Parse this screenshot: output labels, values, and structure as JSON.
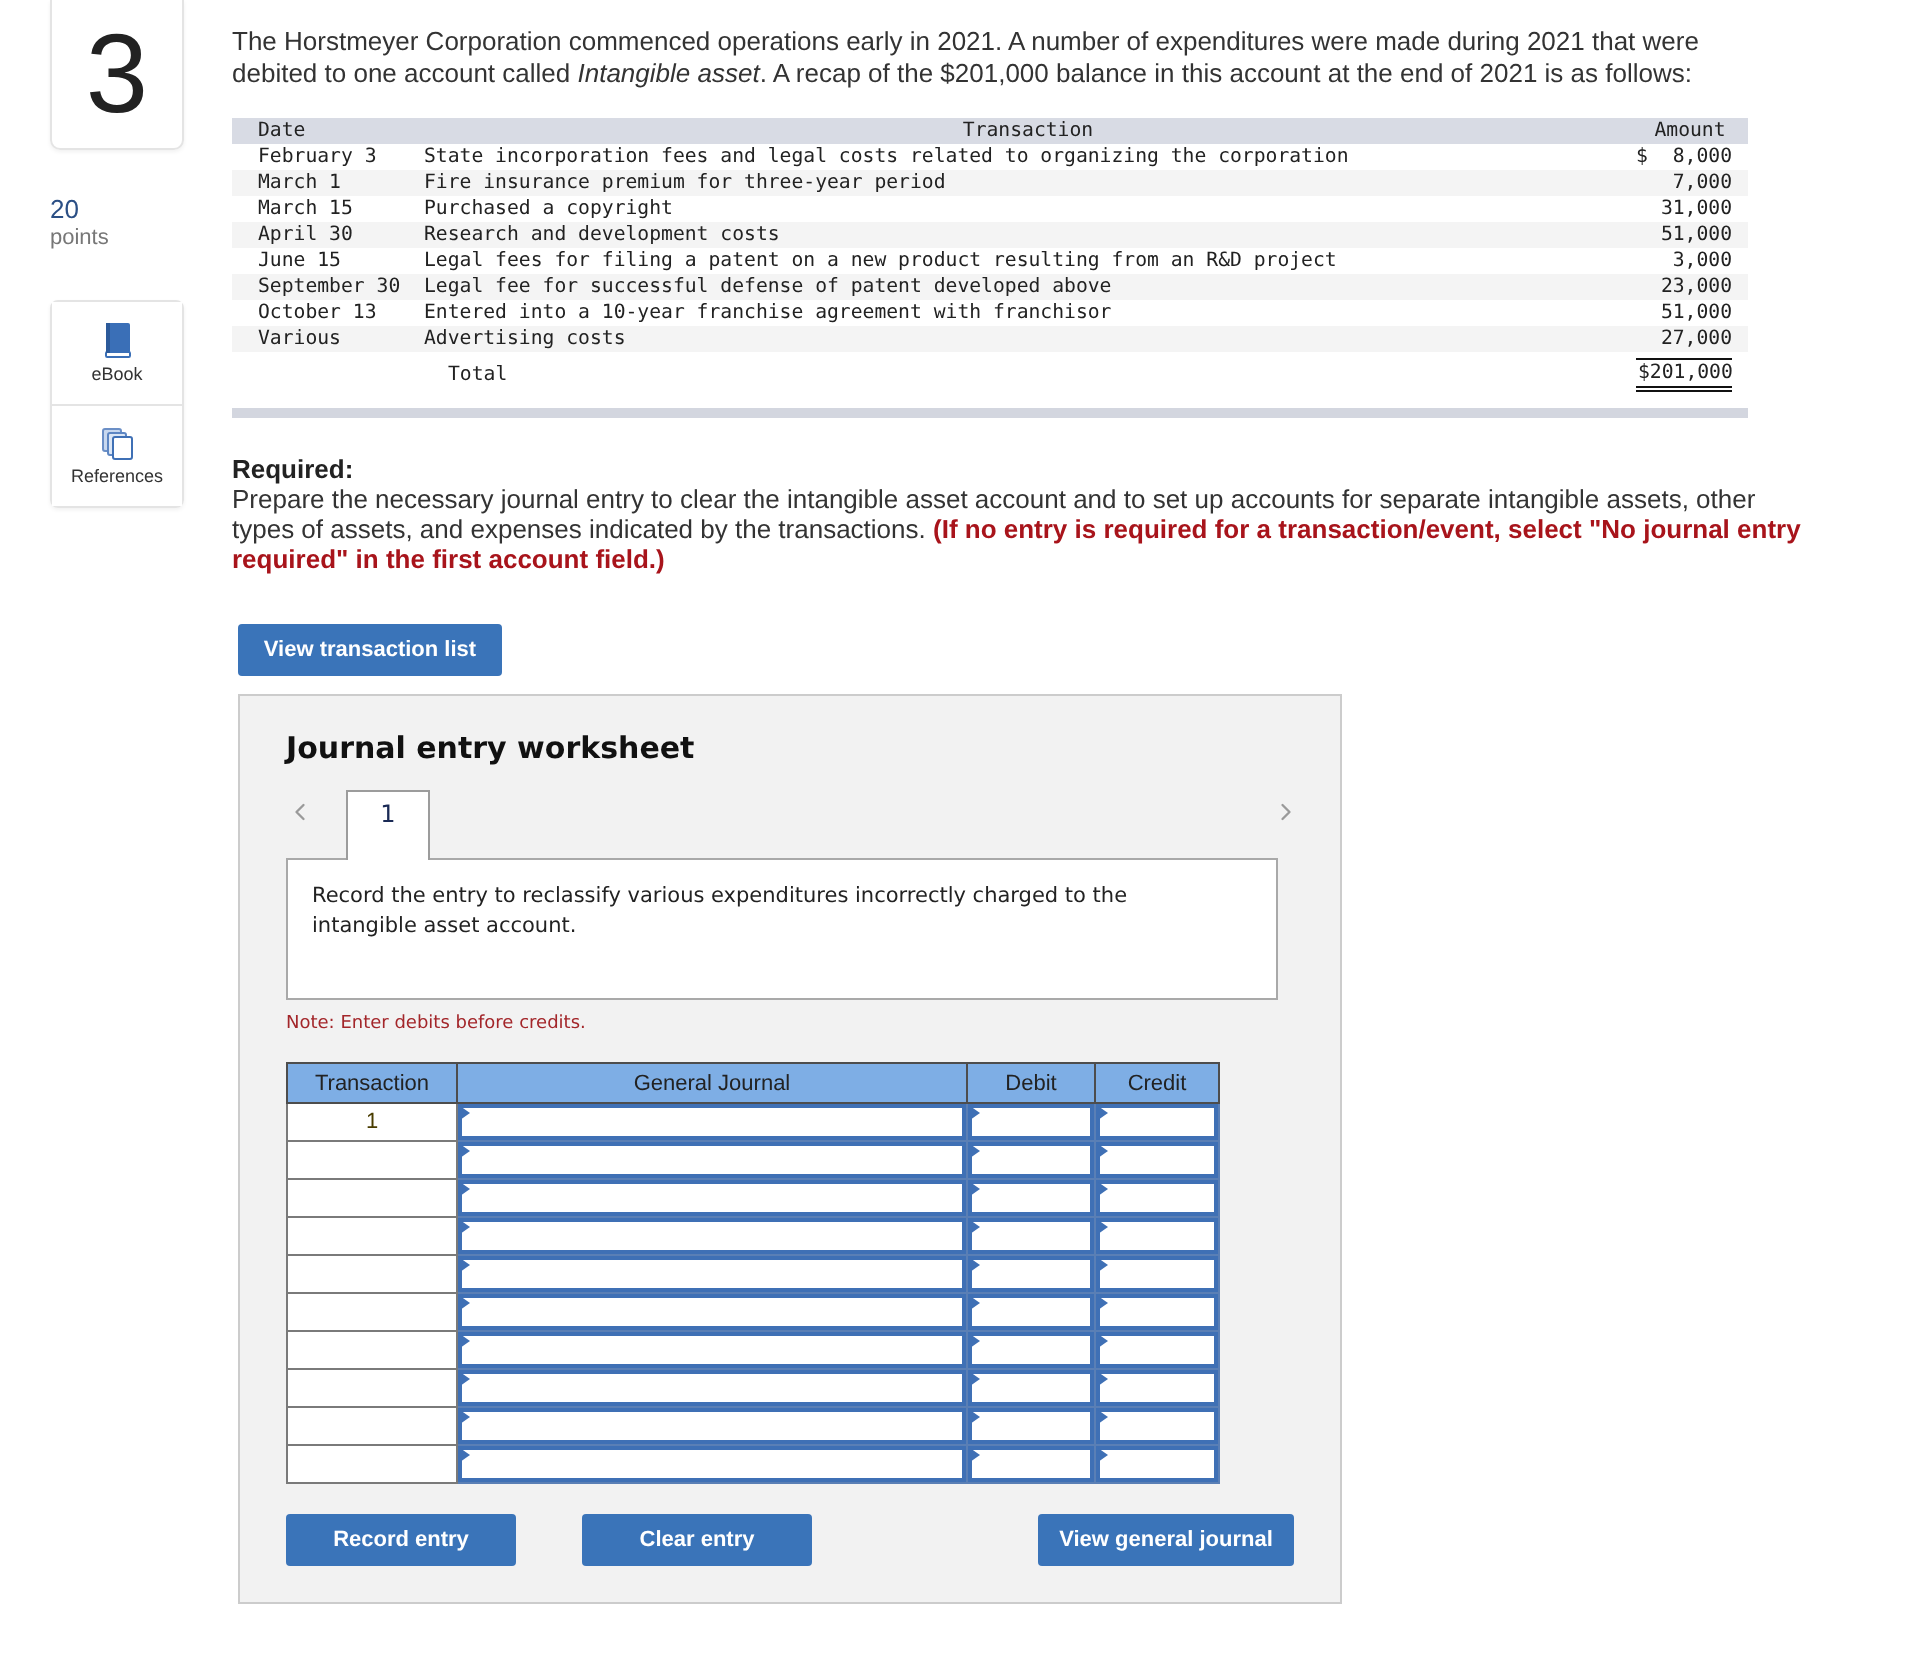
{
  "question": {
    "number": "3",
    "points": "20",
    "points_label": "points"
  },
  "resources": [
    {
      "kind": "ebook",
      "label": "eBook"
    },
    {
      "kind": "references",
      "label": "References"
    }
  ],
  "intro": "The Horstmeyer Corporation commenced operations early in 2021. A number of expenditures were made during 2021 that were debited to one account called *Intangible asset*. A recap of the $201,000 balance in this account at the end of 2021 is as follows:",
  "recap_table": {
    "columns": [
      "Date",
      "Transaction",
      "Amount"
    ],
    "rows": [
      {
        "date": "February 3",
        "description": "State incorporation fees and legal costs related to organizing the corporation",
        "currency": "$",
        "amount": "8,000"
      },
      {
        "date": "March 1",
        "description": "Fire insurance premium for three-year period",
        "amount": "7,000"
      },
      {
        "date": "March 15",
        "description": "Purchased a copyright",
        "amount": "31,000"
      },
      {
        "date": "April 30",
        "description": "Research and development costs",
        "amount": "51,000"
      },
      {
        "date": "June 15",
        "description": "Legal fees for filing a patent on a new product resulting from an R&D project",
        "amount": "3,000"
      },
      {
        "date": "September 30",
        "description": "Legal fee for successful defense of patent developed above",
        "amount": "23,000"
      },
      {
        "date": "October 13",
        "description": "Entered into a 10-year franchise agreement with franchisor",
        "amount": "51,000"
      },
      {
        "date": "Various",
        "description": "Advertising costs",
        "amount": "27,000"
      }
    ],
    "total": {
      "label": "Total",
      "amount": "$201,000"
    }
  },
  "required": {
    "heading": "Required:",
    "text": "Prepare the necessary journal entry to clear the intangible asset account and to set up accounts for separate intangible assets, other types of assets, and expenses indicated by the transactions. **(If no entry is required for a transaction/event, select \"No journal entry required\" in the first account field.)**"
  },
  "view_transactions_button": "View transaction list",
  "worksheet": {
    "title": "Journal entry worksheet",
    "tabs": [
      {
        "label": "1",
        "selected": true
      }
    ],
    "prompt": "Record the entry to reclassify various expenditures incorrectly charged to the intangible asset account.",
    "note": "Note: Enter debits before credits.",
    "journal": {
      "columns": [
        "Transaction",
        "General Journal",
        "Debit",
        "Credit"
      ],
      "lines": [
        {
          "kind": "entry",
          "transaction": "1"
        },
        {
          "kind": "entry"
        },
        {
          "kind": "entry"
        },
        {
          "kind": "entry"
        },
        {
          "kind": "entry"
        },
        {
          "kind": "entry"
        },
        {
          "kind": "entry"
        },
        {
          "kind": "entry"
        },
        {
          "kind": "entry"
        },
        {
          "kind": "entry"
        }
      ]
    },
    "buttons": [
      "Record entry",
      "Clear entry",
      "View general journal"
    ]
  }
}
